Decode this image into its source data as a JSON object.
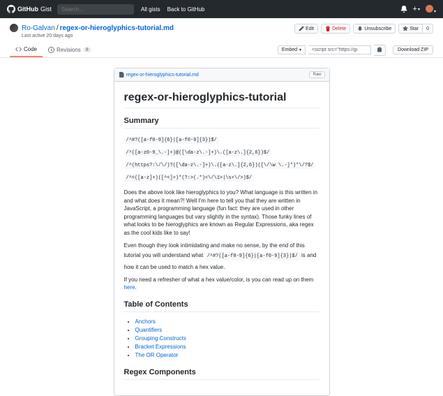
{
  "topbar": {
    "logo_a": "GitHub",
    "logo_b": "Gist",
    "search_placeholder": "Search...",
    "nav1": "All gists",
    "nav2": "Back to GitHub"
  },
  "header": {
    "user": "Ro-Galvan",
    "sep": "/",
    "file": "regex-or-hieroglyphics-tutorial.md",
    "meta": "Last active 20 days ago",
    "edit": "Edit",
    "delete": "Delete",
    "unsubscribe": "Unsubscribe",
    "star": "Star",
    "star_count": "0"
  },
  "tabs": {
    "code": "Code",
    "revisions": "Revisions",
    "rev_count": "8",
    "embed": "Embed",
    "embed_value": "<script src=\"https://gi",
    "download": "Download ZIP"
  },
  "file": {
    "name": "regex-or-hieroglyphics-tutorial.md",
    "raw": "Raw"
  },
  "doc": {
    "h1": "regex-or-hieroglyphics-tutorial",
    "summary": "Summary",
    "code1": "/^#?([a-f0-9]{6}|[a-f0-9]{3})$/",
    "code2": "/^([a-z0-9_\\.-]+)@([\\da-z\\.-]+)\\.([a-z\\.]{2,6})$/",
    "code3": "/^(https?:\\/\\/)?([\\da-z\\.-]+)\\.([a-z\\.]{2,6})([\\/\\w \\.-]*)*\\/?$/",
    "code4": "/^<([a-z]+)([^<]+)*(?:>(.*)<\\/\\1>|\\s+\\/>)$/",
    "p1": "Does the above look like hieroglyphics to you? What language is this written in and what does it mean?! Well I'm here to tell you that they are written in JavaScript, a programming language (fun fact: they are used in other programming languages but vary slightly in the syntax). Those funky lines of what looks to be hieroglyphics are known as Regular Expressions, aka regex as the cool kids like to say!",
    "p2a": "Even though they look intimidating and make no sense, by the end of this tutorial you will understand what ",
    "p2code": "/^#?([a-f0-9]{6}|[a-f0-9]{3})$/",
    "p2b": " is and how it can be used to match a hex value.",
    "p3a": "If you need a refresher of what a hex value/color, is you can read up on them ",
    "p3link": "here",
    "p3b": ".",
    "toc": "Table of Contents",
    "toc_items": [
      "Anchors",
      "Quantifiers",
      "Grouping Constructs",
      "Bracket Expressions",
      "The OR Operator"
    ],
    "components": "Regex Components"
  }
}
